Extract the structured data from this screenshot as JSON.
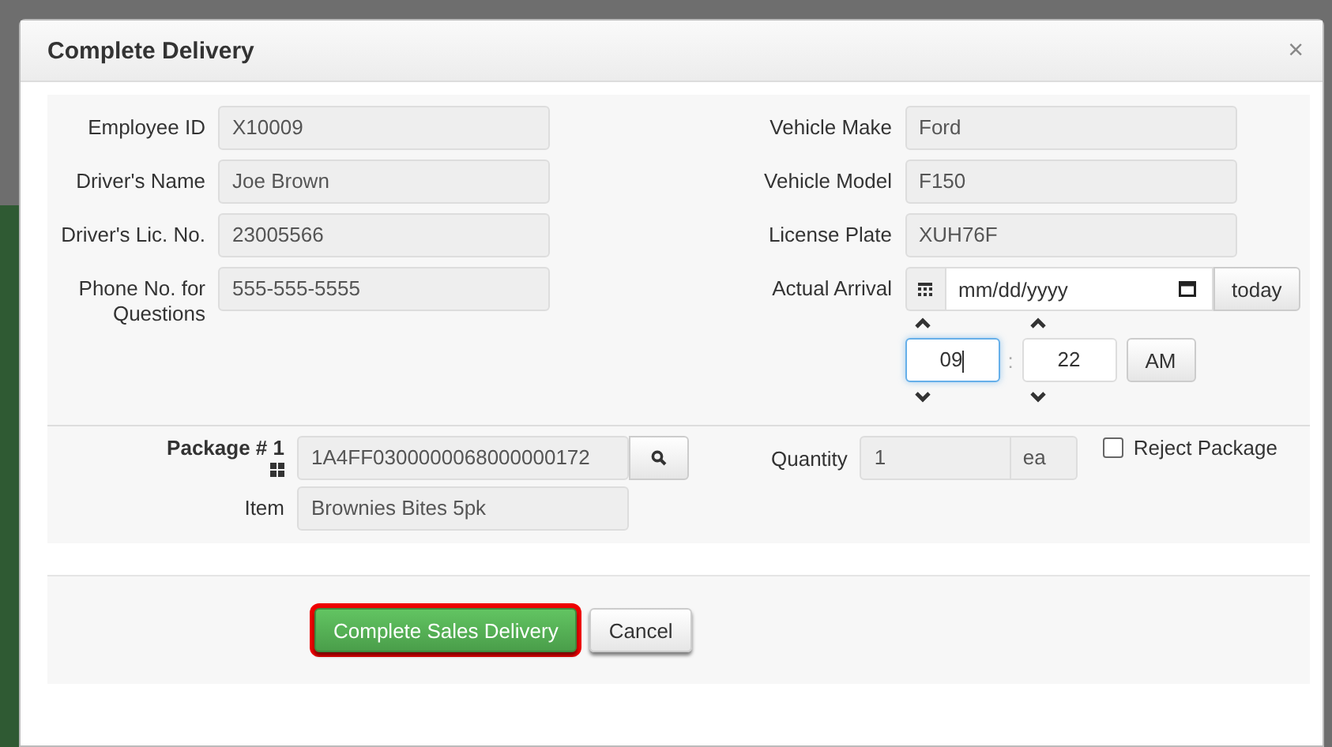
{
  "dialog": {
    "title": "Complete Delivery",
    "close": "×"
  },
  "left_fields": [
    {
      "label": "Employee ID",
      "value": "X10009"
    },
    {
      "label": "Driver's Name",
      "value": "Joe Brown"
    },
    {
      "label": "Driver's Lic. No.",
      "value": "23005566"
    },
    {
      "label": "Phone No. for Questions",
      "value": "555-555-5555"
    }
  ],
  "right_fields": [
    {
      "label": "Vehicle Make",
      "value": "Ford"
    },
    {
      "label": "Vehicle Model",
      "value": "F150"
    },
    {
      "label": "License Plate",
      "value": "XUH76F"
    }
  ],
  "actual_arrival": {
    "label": "Actual Arrival",
    "placeholder": "mm/dd/yyyy",
    "today_button": "today"
  },
  "time": {
    "hour": "09",
    "hour_focused": true,
    "separator": ":",
    "minute": "22",
    "period": "AM"
  },
  "package": {
    "label": "Package # 1",
    "value": "1A4FF0300000068000000172",
    "item_label": "Item",
    "item_value": "Brownies Bites 5pk",
    "quantity_label": "Quantity",
    "quantity_value": "1",
    "unit": "ea",
    "reject": {
      "label": "Reject Package",
      "checked": false
    }
  },
  "buttons": [
    {
      "label": "Complete Sales Delivery",
      "kind": "primary",
      "highlighted": true
    },
    {
      "label": "Cancel",
      "kind": "default",
      "highlighted": false
    }
  ]
}
